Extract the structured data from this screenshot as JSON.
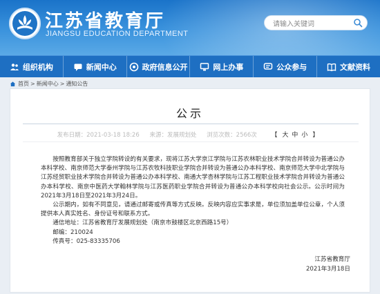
{
  "header": {
    "site_name": "江苏省教育厅",
    "site_sub": "JIANGSU EDUCATION DEPARTMENT",
    "search_placeholder": "请输入关键词",
    "logo_icon": "lotus-book-logo-icon",
    "search_icon": "magnifier-icon"
  },
  "nav": {
    "items": [
      {
        "label": "组织机构",
        "icon": "people-icon"
      },
      {
        "label": "新闻中心",
        "icon": "chat-icon"
      },
      {
        "label": "政府信息公开",
        "icon": "shield-icon"
      },
      {
        "label": "网上办事",
        "icon": "monitor-icon"
      },
      {
        "label": "公众参与",
        "icon": "speech-icon"
      },
      {
        "label": "文献资料",
        "icon": "book-icon"
      }
    ]
  },
  "breadcrumb": {
    "home": "首页",
    "sep": ">",
    "news": "新闻中心",
    "notice": "通知公告"
  },
  "article": {
    "title": "公示",
    "published": "发布日期：2021-03-18 18:26",
    "source": "来源：发展规划处",
    "views": "浏览次数：2566次",
    "font_size_open": "【",
    "font_big": "大",
    "font_mid": "中",
    "font_small": "小",
    "font_size_close": "】",
    "para1": "按照教育部关于独立学院转设的有关要求，现将江苏大学京江学院与江苏农林职业技术学院合并转设为普通公办本科学校、南京师范大学泰州学院与江苏农牧科技职业学院合并转设为普通公办本科学校、南京师范大学中北学院与江苏经贸职业技术学院合并转设为普通公办本科学校、南通大学杏林学院与江苏工程职业技术学院合并转设为普通公办本科学校、南京中医药大学翰林学院与江苏医药职业学院合并转设为普通公办本科学校向社会公示。公示时间为2021年3月18日至2021年3月24日。",
    "para2": "公示期内，如有不同意见，请通过邮寄或传真等方式反映。反映内容应实事求是，单位须加盖单位公章，个人须提供本人真实姓名、身份证号和联系方式。",
    "address": "通信地址：江苏省教育厅发展规划处（南京市鼓楼区北京西路15号）",
    "postcode": "邮编：210024",
    "fax": "传真号：025-83335706",
    "signer": "江苏省教育厅",
    "sign_date": "2021年3月18日"
  },
  "colors": {
    "header_blue": "#1a73c9",
    "nav_blue": "#1e6fc2",
    "page_bg": "#e9eef4"
  }
}
